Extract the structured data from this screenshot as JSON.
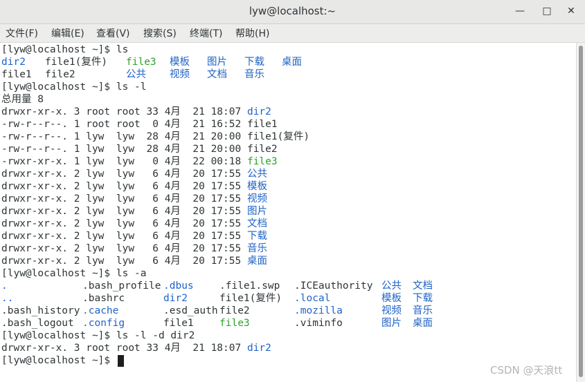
{
  "window": {
    "title": "lyw@localhost:~",
    "minimize_icon": "minimize-icon",
    "maximize_icon": "maximize-icon",
    "close_icon": "close-icon"
  },
  "menu": {
    "items": [
      "文件(F)",
      "编辑(E)",
      "查看(V)",
      "搜索(S)",
      "终端(T)",
      "帮助(H)"
    ]
  },
  "colors": {
    "directory": "#1f63c6",
    "executable": "#2aa32a",
    "text": "#2e3436"
  },
  "terminal": {
    "lines": [
      {
        "segments": [
          {
            "text": "[lyw@localhost ~]$ ls",
            "style": "plain"
          }
        ]
      },
      {
        "segments": [
          {
            "text": "dir2",
            "style": "blue",
            "col": 0
          },
          {
            "text": "file1(复件)",
            "style": "plain",
            "col": 7
          },
          {
            "text": "file3",
            "style": "green",
            "col": 20
          },
          {
            "text": "模板",
            "style": "blue",
            "col": 27
          },
          {
            "text": "图片",
            "style": "blue",
            "col": 33
          },
          {
            "text": "下载",
            "style": "blue",
            "col": 39
          },
          {
            "text": "桌面",
            "style": "blue",
            "col": 45
          }
        ]
      },
      {
        "segments": [
          {
            "text": "file1",
            "style": "plain",
            "col": 0
          },
          {
            "text": "file2",
            "style": "plain",
            "col": 7
          },
          {
            "text": "公共",
            "style": "blue",
            "col": 20
          },
          {
            "text": "视频",
            "style": "blue",
            "col": 27
          },
          {
            "text": "文档",
            "style": "blue",
            "col": 33
          },
          {
            "text": "音乐",
            "style": "blue",
            "col": 39
          }
        ]
      },
      {
        "segments": [
          {
            "text": "[lyw@localhost ~]$ ls -l",
            "style": "plain"
          }
        ]
      },
      {
        "segments": [
          {
            "text": "总用量 8",
            "style": "plain"
          }
        ]
      },
      {
        "segments": [
          {
            "text": "drwxr-xr-x. 3 root root 33 4月  21 18:07 ",
            "style": "plain"
          },
          {
            "text": "dir2",
            "style": "blue"
          }
        ]
      },
      {
        "segments": [
          {
            "text": "-rw-r--r--. 1 root root  0 4月  21 16:52 file1",
            "style": "plain"
          }
        ]
      },
      {
        "segments": [
          {
            "text": "-rw-r--r--. 1 lyw  lyw  28 4月  21 20:00 file1(复件)",
            "style": "plain"
          }
        ]
      },
      {
        "segments": [
          {
            "text": "-rw-r--r--. 1 lyw  lyw  28 4月  21 20:00 file2",
            "style": "plain"
          }
        ]
      },
      {
        "segments": [
          {
            "text": "-rwxr-xr-x. 1 lyw  lyw   0 4月  22 00:18 ",
            "style": "plain"
          },
          {
            "text": "file3",
            "style": "green"
          }
        ]
      },
      {
        "segments": [
          {
            "text": "drwxr-xr-x. 2 lyw  lyw   6 4月  20 17:55 ",
            "style": "plain"
          },
          {
            "text": "公共",
            "style": "blue"
          }
        ]
      },
      {
        "segments": [
          {
            "text": "drwxr-xr-x. 2 lyw  lyw   6 4月  20 17:55 ",
            "style": "plain"
          },
          {
            "text": "模板",
            "style": "blue"
          }
        ]
      },
      {
        "segments": [
          {
            "text": "drwxr-xr-x. 2 lyw  lyw   6 4月  20 17:55 ",
            "style": "plain"
          },
          {
            "text": "视频",
            "style": "blue"
          }
        ]
      },
      {
        "segments": [
          {
            "text": "drwxr-xr-x. 2 lyw  lyw   6 4月  20 17:55 ",
            "style": "plain"
          },
          {
            "text": "图片",
            "style": "blue"
          }
        ]
      },
      {
        "segments": [
          {
            "text": "drwxr-xr-x. 2 lyw  lyw   6 4月  20 17:55 ",
            "style": "plain"
          },
          {
            "text": "文档",
            "style": "blue"
          }
        ]
      },
      {
        "segments": [
          {
            "text": "drwxr-xr-x. 2 lyw  lyw   6 4月  20 17:55 ",
            "style": "plain"
          },
          {
            "text": "下载",
            "style": "blue"
          }
        ]
      },
      {
        "segments": [
          {
            "text": "drwxr-xr-x. 2 lyw  lyw   6 4月  20 17:55 ",
            "style": "plain"
          },
          {
            "text": "音乐",
            "style": "blue"
          }
        ]
      },
      {
        "segments": [
          {
            "text": "drwxr-xr-x. 2 lyw  lyw   6 4月  20 17:55 ",
            "style": "plain"
          },
          {
            "text": "桌面",
            "style": "blue"
          }
        ]
      },
      {
        "segments": [
          {
            "text": "[lyw@localhost ~]$ ls -a",
            "style": "plain"
          }
        ]
      },
      {
        "segments": [
          {
            "text": ".",
            "style": "blue",
            "col": 0
          },
          {
            "text": ".bash_profile",
            "style": "plain",
            "col": 13
          },
          {
            "text": ".dbus",
            "style": "blue",
            "col": 26
          },
          {
            "text": ".file1.swp",
            "style": "plain",
            "col": 35
          },
          {
            "text": ".ICEauthority",
            "style": "plain",
            "col": 47
          },
          {
            "text": "公共",
            "style": "blue",
            "col": 61
          },
          {
            "text": "文档",
            "style": "blue",
            "col": 66
          }
        ]
      },
      {
        "segments": [
          {
            "text": "..",
            "style": "blue",
            "col": 0
          },
          {
            "text": ".bashrc",
            "style": "plain",
            "col": 13
          },
          {
            "text": "dir2",
            "style": "blue",
            "col": 26
          },
          {
            "text": "file1(复件)",
            "style": "plain",
            "col": 35
          },
          {
            "text": ".local",
            "style": "blue",
            "col": 47
          },
          {
            "text": "模板",
            "style": "blue",
            "col": 61
          },
          {
            "text": "下载",
            "style": "blue",
            "col": 66
          }
        ]
      },
      {
        "segments": [
          {
            "text": ".bash_history",
            "style": "plain",
            "col": 0
          },
          {
            "text": ".cache",
            "style": "blue",
            "col": 13
          },
          {
            "text": ".esd_auth",
            "style": "plain",
            "col": 26
          },
          {
            "text": "file2",
            "style": "plain",
            "col": 35
          },
          {
            "text": ".mozilla",
            "style": "blue",
            "col": 47
          },
          {
            "text": "视频",
            "style": "blue",
            "col": 61
          },
          {
            "text": "音乐",
            "style": "blue",
            "col": 66
          }
        ]
      },
      {
        "segments": [
          {
            "text": ".bash_logout",
            "style": "plain",
            "col": 0
          },
          {
            "text": ".config",
            "style": "blue",
            "col": 13
          },
          {
            "text": "file1",
            "style": "plain",
            "col": 26
          },
          {
            "text": "file3",
            "style": "green",
            "col": 35
          },
          {
            "text": ".viminfo",
            "style": "plain",
            "col": 47
          },
          {
            "text": "图片",
            "style": "blue",
            "col": 61
          },
          {
            "text": "桌面",
            "style": "blue",
            "col": 66
          }
        ]
      },
      {
        "segments": [
          {
            "text": "[lyw@localhost ~]$ ls -l -d dir2",
            "style": "plain"
          }
        ]
      },
      {
        "segments": [
          {
            "text": "drwxr-xr-x. 3 root root 33 4月  21 18:07 ",
            "style": "plain"
          },
          {
            "text": "dir2",
            "style": "blue"
          }
        ]
      },
      {
        "segments": [
          {
            "text": "[lyw@localhost ~]$ ",
            "style": "plain"
          }
        ],
        "cursor": true
      }
    ]
  },
  "watermark": "CSDN @天浪tt"
}
